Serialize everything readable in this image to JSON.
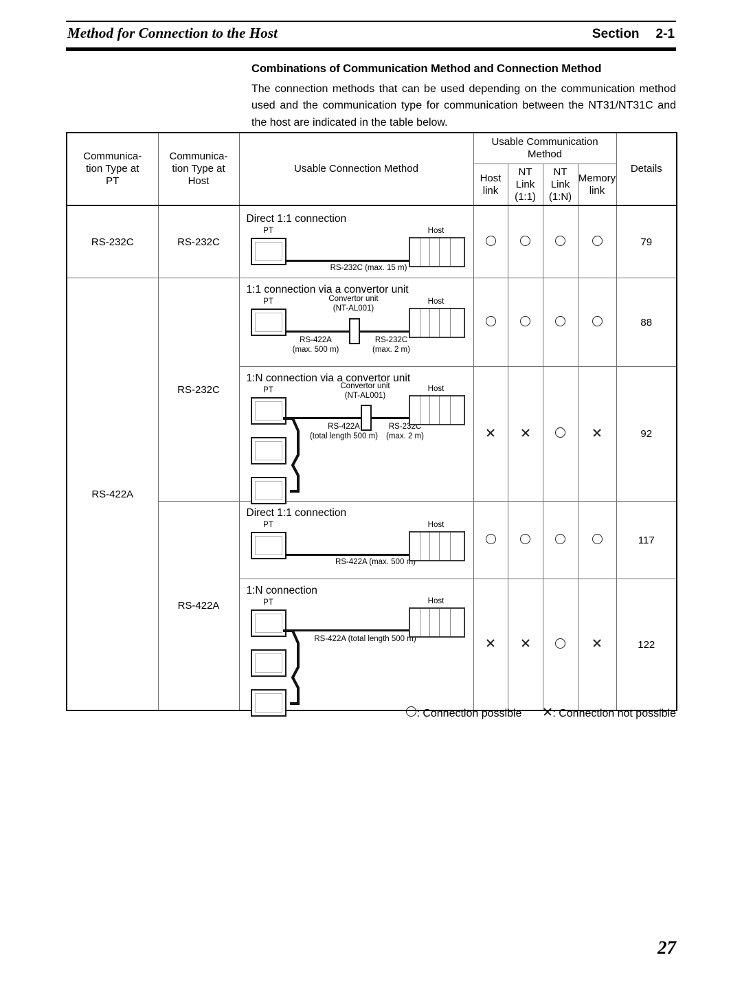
{
  "header": {
    "title": "Method for Connection to the Host",
    "section_label": "Section",
    "section_number": "2-1"
  },
  "intro": {
    "heading": "Combinations of Communication Method and Connection Method",
    "body": "The connection methods that can be used depending on the communication method used and the communication type for communication between the NT31/NT31C and the host are indicated in the table below."
  },
  "table": {
    "headers": {
      "comm_type_pt": "Communica-\ntion Type at\nPT",
      "comm_type_pt_l1": "Communica-",
      "comm_type_pt_l2": "tion Type at",
      "comm_type_pt_l3": "PT",
      "comm_type_host_l1": "Communica-",
      "comm_type_host_l2": "tion Type at",
      "comm_type_host_l3": "Host",
      "usable_connection_method": "Usable Connection Method",
      "usable_comm_method_l1": "Usable Communication",
      "usable_comm_method_l2": "Method",
      "host_link_l1": "Host",
      "host_link_l2": "link",
      "nt_link_11_l1": "NT",
      "nt_link_11_l2": "Link",
      "nt_link_11_l3": "(1:1)",
      "nt_link_1n_l1": "NT",
      "nt_link_1n_l2": "Link",
      "nt_link_1n_l3": "(1:N)",
      "memory_link_l1": "Memory",
      "memory_link_l2": "link",
      "details": "Details"
    },
    "rows": [
      {
        "pt_type": "RS-232C",
        "host_type": "RS-232C",
        "diagram": {
          "title": "Direct 1:1 connection",
          "pt_label": "PT",
          "host_label": "Host",
          "cable_label": "RS-232C (max. 15 m)"
        },
        "host_link": "circle",
        "nt_link_11": "circle",
        "nt_link_1n": "circle",
        "memory_link": "circle",
        "details": "79"
      },
      {
        "pt_type": "",
        "host_type": "RS-232C",
        "diagram": {
          "title": "1:1 connection via a convertor unit",
          "pt_label": "PT",
          "host_label": "Host",
          "convertor_l1": "Convertor unit",
          "convertor_l2": "(NT-AL001)",
          "cable_left_l1": "RS-422A",
          "cable_left_l2": "(max. 500 m)",
          "cable_right_l1": "RS-232C",
          "cable_right_l2": "(max. 2 m)"
        },
        "host_link": "circle",
        "nt_link_11": "circle",
        "nt_link_1n": "circle",
        "memory_link": "circle",
        "details": "88"
      },
      {
        "pt_type": "RS-422A",
        "host_type": "",
        "diagram": {
          "title": "1:N connection via a convertor unit",
          "pt_label": "PT",
          "host_label": "Host",
          "convertor_l1": "Convertor unit",
          "convertor_l2": "(NT-AL001)",
          "cable_left_l1": "RS-422A",
          "cable_left_l2": "(total length 500 m)",
          "cable_right_l1": "RS-232C",
          "cable_right_l2": "(max. 2 m)"
        },
        "host_link": "cross",
        "nt_link_11": "cross",
        "nt_link_1n": "circle",
        "memory_link": "cross",
        "details": "92"
      },
      {
        "pt_type": "",
        "host_type": "RS-422A",
        "diagram": {
          "title": "Direct 1:1 connection",
          "pt_label": "PT",
          "host_label": "Host",
          "cable_label": "RS-422A (max. 500 m)"
        },
        "host_link": "circle",
        "nt_link_11": "circle",
        "nt_link_1n": "circle",
        "memory_link": "circle",
        "details": "117"
      },
      {
        "pt_type": "",
        "host_type": "",
        "diagram": {
          "title": "1:N connection",
          "pt_label": "PT",
          "host_label": "Host",
          "cable_label": "RS-422A (total length 500 m)"
        },
        "host_link": "cross",
        "nt_link_11": "cross",
        "nt_link_1n": "circle",
        "memory_link": "cross",
        "details": "122"
      }
    ]
  },
  "legend": {
    "possible": ": Connection possible",
    "not_possible": ": Connection not possible"
  },
  "footer": {
    "page_number": "27"
  }
}
